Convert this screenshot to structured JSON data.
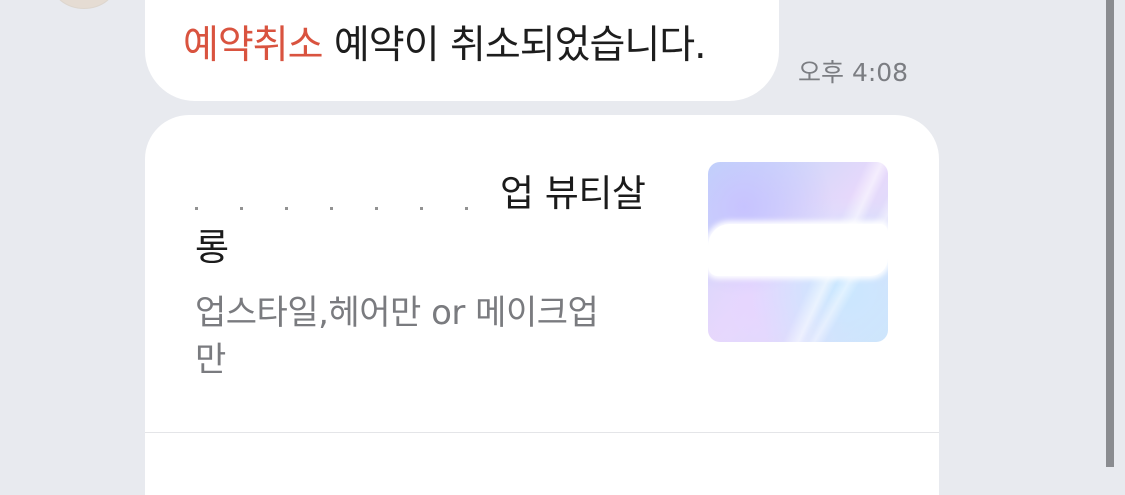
{
  "chat": {
    "message": {
      "tag": "예약취소",
      "text": " 예약이 취소되었습니다."
    },
    "timestamp": "오후 4:08"
  },
  "card": {
    "title_line1_visible": "업 뷰티살",
    "title_line2": "롱",
    "subtitle_line1": "업스타일,헤어만 or 메이크업",
    "subtitle_line2": "만",
    "thumbnail_icon": "salon-thumbnail"
  },
  "colors": {
    "background": "#e8eaef",
    "tag_red": "#d9533f",
    "bubble": "#ffffff",
    "timestamp": "#7b7d82"
  }
}
